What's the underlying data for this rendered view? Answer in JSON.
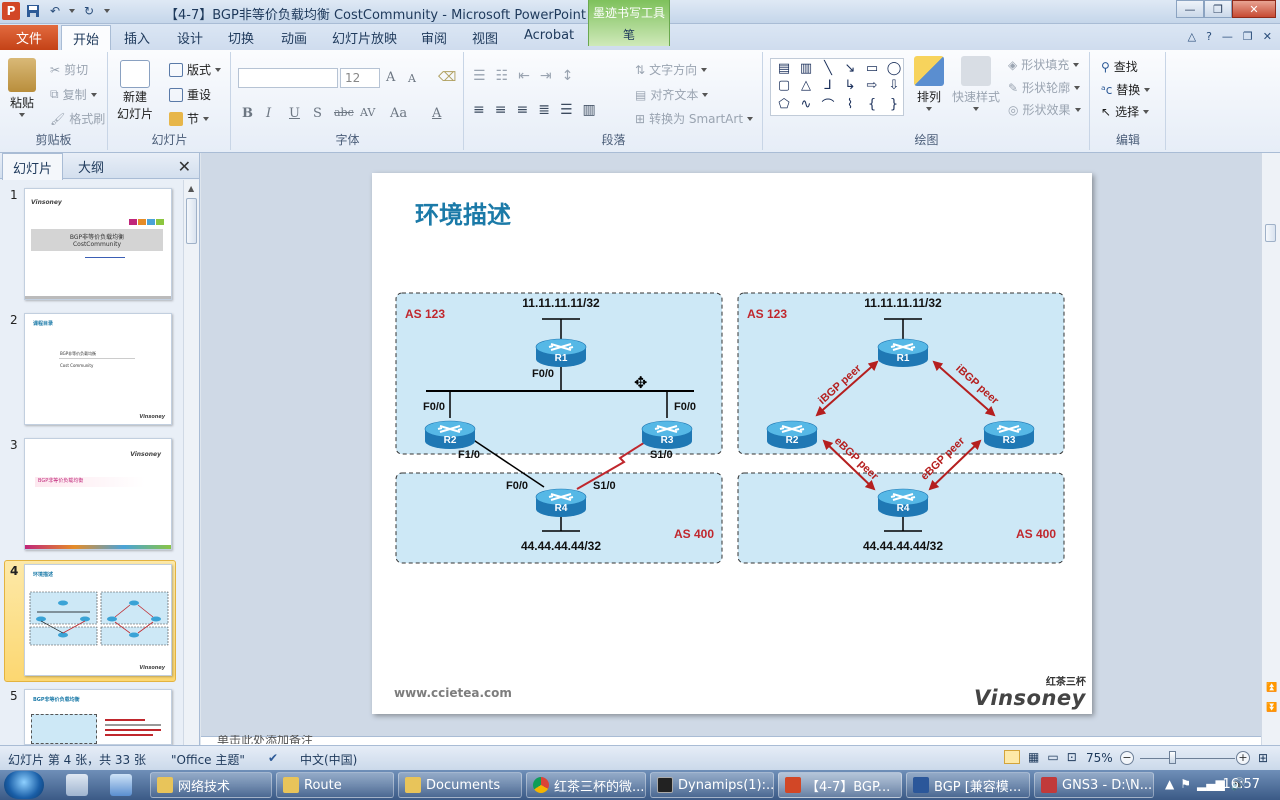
{
  "window": {
    "title": "【4-7】BGP非等价负载均衡 CostCommunity - Microsoft PowerPoint",
    "contextual_tools": "墨迹书写工具",
    "contextual_tab": "笔"
  },
  "tabs": {
    "file": "文件",
    "items": [
      "开始",
      "插入",
      "设计",
      "切换",
      "动画",
      "幻灯片放映",
      "审阅",
      "视图",
      "Acrobat"
    ],
    "active": "开始"
  },
  "ribbon": {
    "clipboard": {
      "label": "剪贴板",
      "paste": "粘贴",
      "cut": "剪切",
      "copy": "复制",
      "format_painter": "格式刷"
    },
    "slides": {
      "label": "幻灯片",
      "new_slide_1": "新建",
      "new_slide_2": "幻灯片",
      "layout": "版式",
      "reset": "重设",
      "section": "节"
    },
    "font": {
      "label": "字体",
      "font_name": "",
      "font_size": "12",
      "bold": "B",
      "italic": "I",
      "underline": "U",
      "shadow": "S",
      "strike": "abc",
      "spacing": "AV",
      "case": "Aa",
      "grow": "A",
      "shrink": "A",
      "color": "A"
    },
    "paragraph": {
      "label": "段落",
      "text_direction": "文字方向",
      "align_text": "对齐文本",
      "smartart": "转换为 SmartArt"
    },
    "drawing": {
      "label": "绘图",
      "arrange": "排列",
      "quick_styles": "快速样式",
      "shape_fill": "形状填充",
      "shape_outline": "形状轮廓",
      "shape_effects": "形状效果"
    },
    "editing": {
      "label": "编辑",
      "find": "查找",
      "replace": "替换",
      "select": "选择"
    }
  },
  "pane": {
    "tab_slides": "幻灯片",
    "tab_outline": "大纲",
    "thumbnails": [
      {
        "num": "1",
        "title_line1": "BGP非等价负载均衡",
        "title_line2": "CostCommunity"
      },
      {
        "num": "2",
        "title": "课程目录",
        "item1": "BGP非等价负载均衡",
        "item2": "Cost Community"
      },
      {
        "num": "3",
        "title": "BGP非等价负载均衡"
      },
      {
        "num": "4",
        "title": "环境描述"
      },
      {
        "num": "5",
        "title": "BGP非等价负载均衡"
      }
    ]
  },
  "slide": {
    "title": "环境描述",
    "footer_url": "www.ccietea.com",
    "brand_cn": "红茶三杯",
    "brand_en": "Vinsoney",
    "left": {
      "as_top": "AS 123",
      "as_bottom": "AS 400",
      "prefix_r1": "11.11.11.11/32",
      "prefix_r4": "44.44.44.44/32",
      "r1": "R1",
      "r2": "R2",
      "r3": "R3",
      "r4": "R4",
      "r1_if": "F0/0",
      "r2_if_top": "F0/0",
      "r3_if_top": "F0/0",
      "r2_if_bottom": "F1/0",
      "r3_if_bottom": "S1/0",
      "r4_if_left": "F0/0",
      "r4_if_right": "S1/0"
    },
    "right": {
      "as_top": "AS 123",
      "as_bottom": "AS 400",
      "prefix_r1": "11.11.11.11/32",
      "prefix_r4": "44.44.44.44/32",
      "r1": "R1",
      "r2": "R2",
      "r3": "R3",
      "r4": "R4",
      "peer_r1_r2": "iBGP peer",
      "peer_r1_r3": "iBGP peer",
      "peer_r2_r4": "eBGP peer",
      "peer_r3_r4": "eBGP peer"
    },
    "notes_placeholder": "单击此处添加备注"
  },
  "status": {
    "slide_pos": "幻灯片 第 4 张，共 33 张",
    "theme": "\"Office 主题\"",
    "language": "中文(中国)",
    "zoom": "75%"
  },
  "taskbar": {
    "items": [
      "网络技术",
      "Route",
      "Documents",
      "红茶三杯的微...",
      "Dynamips(1):...",
      "【4-7】BGP...",
      "BGP [兼容模...",
      "GNS3 - D:\\N..."
    ],
    "clock": "16:57"
  },
  "colors": {
    "accent_title": "#1b7aa8",
    "as_label": "#c0272d",
    "peer_arrow": "#b51f1f",
    "as_box_fill": "#cde8f6",
    "file_tab": "#d3552a"
  }
}
